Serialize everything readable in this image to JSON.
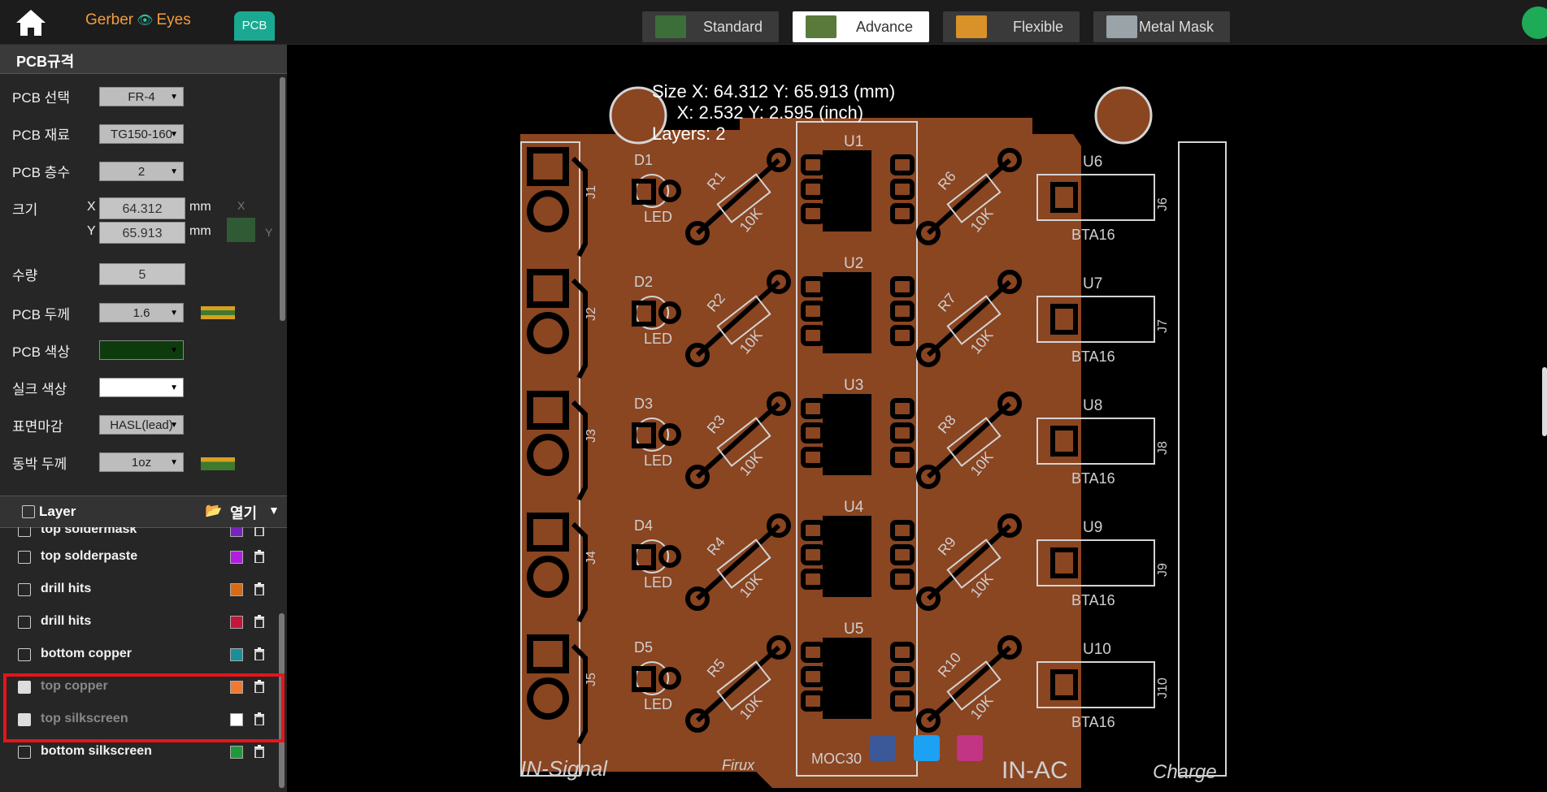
{
  "header": {
    "brand_left": "Gerber",
    "brand_right": "Eyes",
    "pcb_button": "PCB",
    "tabs": [
      {
        "label": "Standard",
        "thumb_color": "#3c6e3a"
      },
      {
        "label": "Advance",
        "thumb_color": "#5a7a3b"
      },
      {
        "label": "Flexible",
        "thumb_color": "#d9922a"
      },
      {
        "label": "Metal Mask",
        "thumb_color": "#9aa3a8"
      }
    ],
    "active_tab": "Advance"
  },
  "spec": {
    "title": "PCB규격",
    "pcb_select_label": "PCB 선택",
    "pcb_select_value": "FR-4",
    "material_label": "PCB 재료",
    "material_value": "TG150-160",
    "layers_label": "PCB 층수",
    "layers_value": "2",
    "size_label": "크기",
    "x_label": "X",
    "x_value": "64.312",
    "x_unit": "mm",
    "y_label": "Y",
    "y_value": "65.913",
    "y_unit": "mm",
    "axis_x": "X",
    "axis_y": "Y",
    "qty_label": "수량",
    "qty_value": "5",
    "thickness_label": "PCB 두께",
    "thickness_value": "1.6",
    "color_label": "PCB 색상",
    "color_value": "#0d3b0d",
    "silk_label": "실크 색상",
    "silk_value": "#ffffff",
    "finish_label": "표면마감",
    "finish_value": "HASL(lead)",
    "copper_label": "동박 두께",
    "copper_value": "1oz"
  },
  "layers": {
    "title": "Layer",
    "open_label": "열기",
    "items": [
      {
        "name": "top soldermask",
        "color": "#7a22c0",
        "dim": false
      },
      {
        "name": "top solderpaste",
        "color": "#b11ee0",
        "dim": false
      },
      {
        "name": "drill hits",
        "color": "#d86a12",
        "dim": false
      },
      {
        "name": "drill hits",
        "color": "#c4163c",
        "dim": false
      },
      {
        "name": "bottom copper",
        "color": "#1a8f9a",
        "dim": false
      },
      {
        "name": "top copper",
        "color": "#f07a32",
        "dim": true
      },
      {
        "name": "top silkscreen",
        "color": "#ffffff",
        "dim": true
      },
      {
        "name": "bottom silkscreen",
        "color": "#1f9a3a",
        "dim": false
      }
    ]
  },
  "board": {
    "info_line1": "Size X: 64.312 Y: 65.913 (mm)",
    "info_line2": "X: 2.532 Y: 2.595 (inch)",
    "info_line3": "Layers: 2",
    "left_ids": [
      "D1",
      "D2",
      "D3",
      "D4",
      "D5"
    ],
    "left_jacks": [
      "J1",
      "J2",
      "J3",
      "J4",
      "J5"
    ],
    "left_res": [
      "R1",
      "R2",
      "R3",
      "R4",
      "R5"
    ],
    "mid_ids": [
      "U1",
      "U2",
      "U3",
      "U4",
      "U5"
    ],
    "right_res": [
      "R6",
      "R7",
      "R8",
      "R9",
      "R10"
    ],
    "triac_ids": [
      "U6",
      "U7",
      "U8",
      "U9",
      "U10"
    ],
    "right_jacks": [
      "J6",
      "J7",
      "J8",
      "J9",
      "J10"
    ],
    "led": "LED",
    "res_value": "10K",
    "triac_value": "BTA16",
    "label_signal": "IN-Signal",
    "label_firux": "Firux",
    "label_moc": "MOC30",
    "label_inac": "IN-AC",
    "label_charge": "Charge"
  }
}
